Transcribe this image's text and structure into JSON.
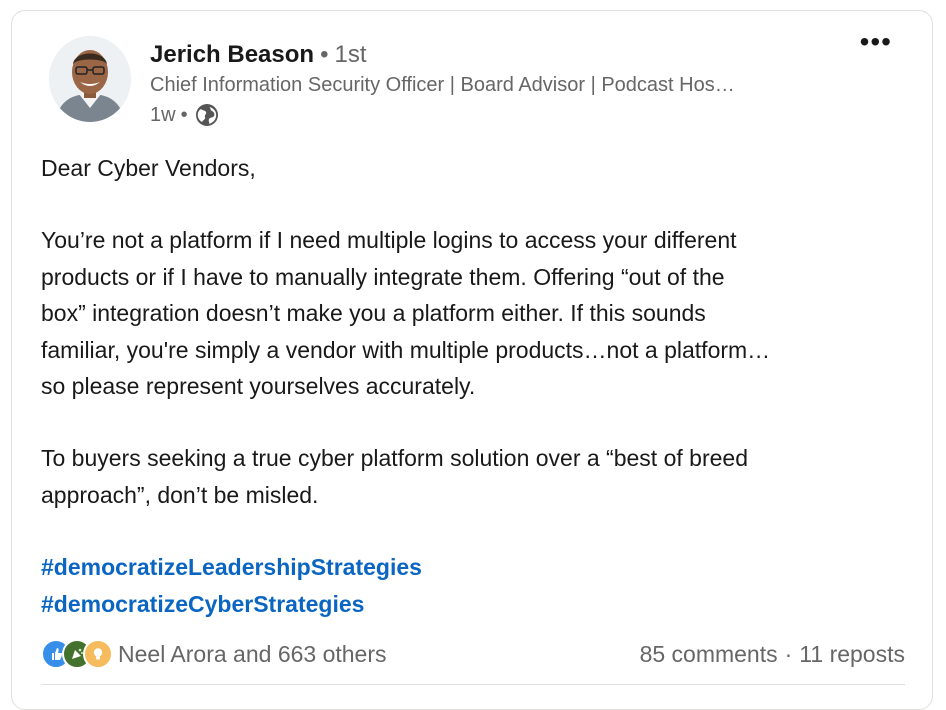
{
  "post": {
    "author": {
      "name": "Jerich Beason",
      "separator": "•",
      "degree": "1st",
      "headline": "Chief Information Security Officer | Board Advisor | Podcast Hos…",
      "time": "1w",
      "visibility_icon": "globe-icon"
    },
    "menu_icon": "more-icon",
    "menu_label": "•••",
    "body": {
      "greeting": "Dear Cyber Vendors,",
      "paragraph1": "You’re not a platform if I need multiple logins to access your different\nproducts or if I have to manually integrate them. Offering “out of the\nbox” integration doesn’t make you a platform either. If this sounds\nfamiliar, you're simply a vendor with multiple products…not a platform…\nso please represent yourselves accurately.",
      "paragraph2": "To buyers seeking a true cyber platform solution over a “best of breed\napproach”, don’t be misled.",
      "hashtags": [
        "#democratizeLeadershipStrategies",
        "#democratizeCyberStrategies"
      ]
    },
    "social": {
      "reaction_icons": [
        "like-icon",
        "celebrate-icon",
        "insightful-icon"
      ],
      "reactions_text": "Neel Arora and 663 others",
      "comments": "85 comments",
      "separator": "·",
      "reposts": "11 reposts"
    },
    "colors": {
      "link": "#0a66c2",
      "secondary_text": "#666666",
      "primary_text": "#191919",
      "like": "#378fe9",
      "celebrate": "#44712e",
      "insightful": "#f5bb5c"
    }
  }
}
